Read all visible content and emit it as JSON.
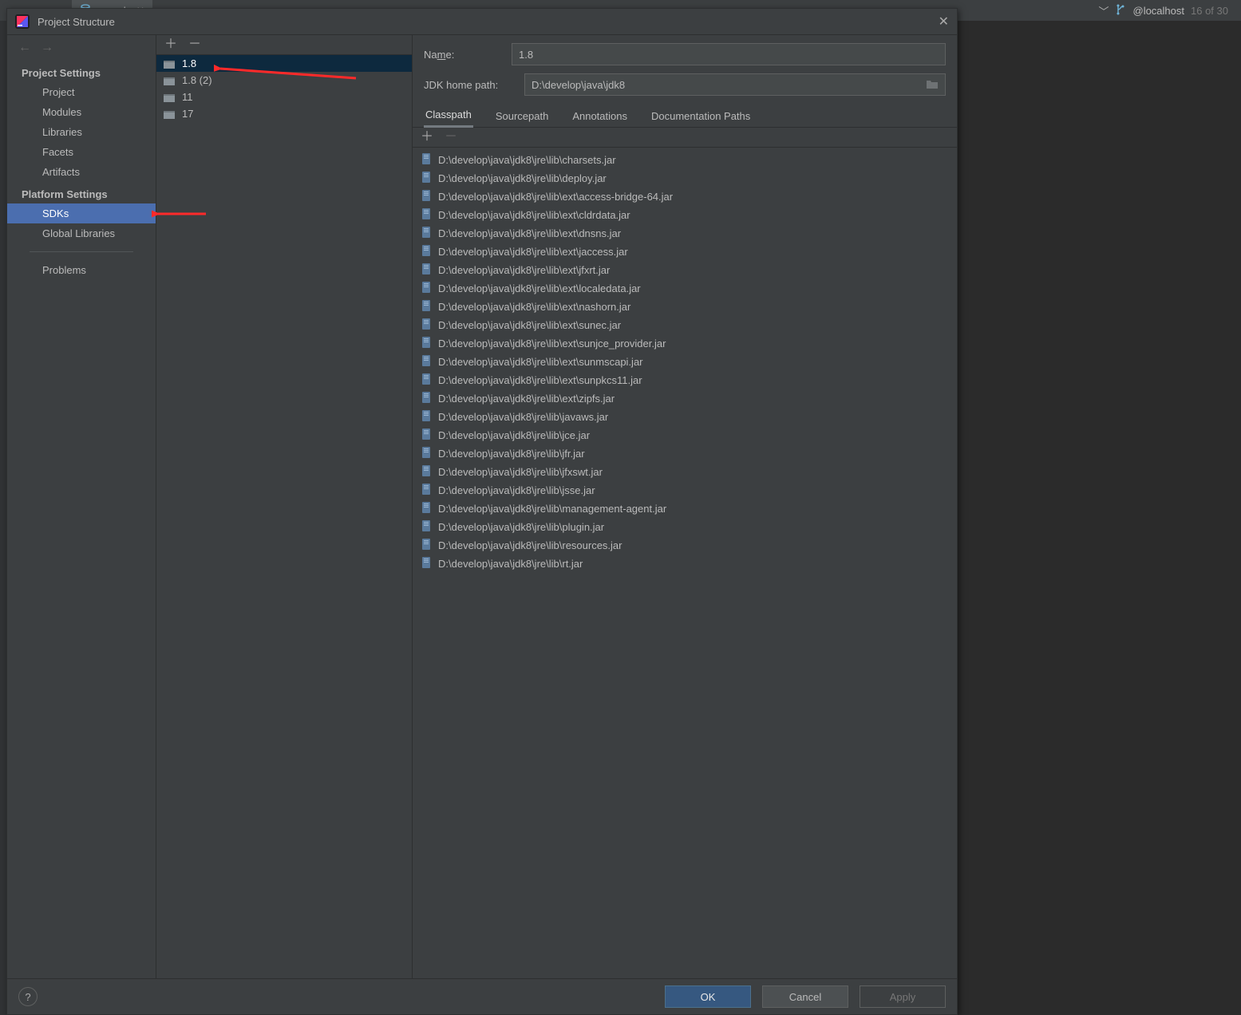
{
  "editor": {
    "tab_label": "console",
    "branch_prefix": "@",
    "branch_name": "localhost",
    "branch_count": "16 of 30"
  },
  "dialog": {
    "title": "Project Structure"
  },
  "nav": {
    "section_project": "Project Settings",
    "project": "Project",
    "modules": "Modules",
    "libraries": "Libraries",
    "facets": "Facets",
    "artifacts": "Artifacts",
    "section_platform": "Platform Settings",
    "sdks": "SDKs",
    "global_libraries": "Global Libraries",
    "problems": "Problems"
  },
  "sdk_items": [
    {
      "label": "1.8"
    },
    {
      "label": "1.8 (2)"
    },
    {
      "label": "11"
    },
    {
      "label": "17"
    }
  ],
  "form": {
    "name_label_pre": "Na",
    "name_label_u": "m",
    "name_label_post": "e:",
    "name_value": "1.8",
    "path_label": "JDK home path:",
    "path_value": "D:\\develop\\java\\jdk8"
  },
  "tabs": {
    "classpath": "Classpath",
    "sourcepath": "Sourcepath",
    "annotations": "Annotations",
    "documentation": "Documentation Paths"
  },
  "classpath": [
    "D:\\develop\\java\\jdk8\\jre\\lib\\charsets.jar",
    "D:\\develop\\java\\jdk8\\jre\\lib\\deploy.jar",
    "D:\\develop\\java\\jdk8\\jre\\lib\\ext\\access-bridge-64.jar",
    "D:\\develop\\java\\jdk8\\jre\\lib\\ext\\cldrdata.jar",
    "D:\\develop\\java\\jdk8\\jre\\lib\\ext\\dnsns.jar",
    "D:\\develop\\java\\jdk8\\jre\\lib\\ext\\jaccess.jar",
    "D:\\develop\\java\\jdk8\\jre\\lib\\ext\\jfxrt.jar",
    "D:\\develop\\java\\jdk8\\jre\\lib\\ext\\localedata.jar",
    "D:\\develop\\java\\jdk8\\jre\\lib\\ext\\nashorn.jar",
    "D:\\develop\\java\\jdk8\\jre\\lib\\ext\\sunec.jar",
    "D:\\develop\\java\\jdk8\\jre\\lib\\ext\\sunjce_provider.jar",
    "D:\\develop\\java\\jdk8\\jre\\lib\\ext\\sunmscapi.jar",
    "D:\\develop\\java\\jdk8\\jre\\lib\\ext\\sunpkcs11.jar",
    "D:\\develop\\java\\jdk8\\jre\\lib\\ext\\zipfs.jar",
    "D:\\develop\\java\\jdk8\\jre\\lib\\javaws.jar",
    "D:\\develop\\java\\jdk8\\jre\\lib\\jce.jar",
    "D:\\develop\\java\\jdk8\\jre\\lib\\jfr.jar",
    "D:\\develop\\java\\jdk8\\jre\\lib\\jfxswt.jar",
    "D:\\develop\\java\\jdk8\\jre\\lib\\jsse.jar",
    "D:\\develop\\java\\jdk8\\jre\\lib\\management-agent.jar",
    "D:\\develop\\java\\jdk8\\jre\\lib\\plugin.jar",
    "D:\\develop\\java\\jdk8\\jre\\lib\\resources.jar",
    "D:\\develop\\java\\jdk8\\jre\\lib\\rt.jar"
  ],
  "buttons": {
    "ok": "OK",
    "cancel": "Cancel",
    "apply": "Apply"
  }
}
